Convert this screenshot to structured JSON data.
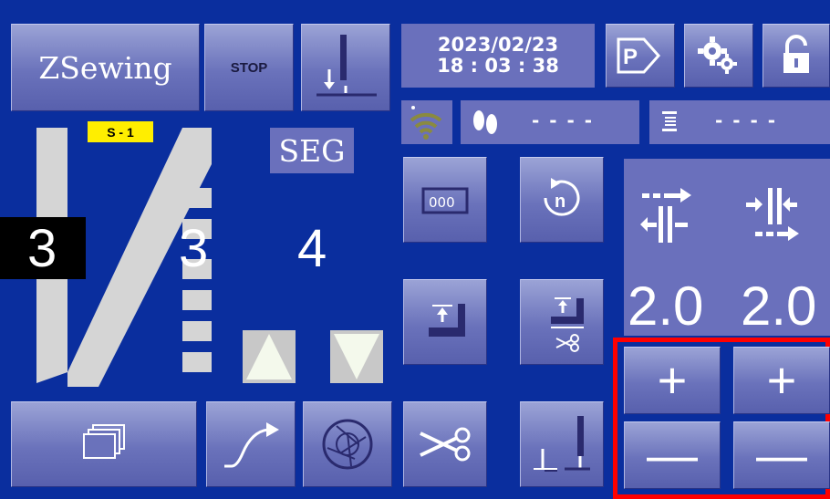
{
  "header": {
    "brand": "ZSewing",
    "stop_label": "STOP",
    "date": "2023/02/23",
    "time": "18 : 03 : 38"
  },
  "status": {
    "foot_count": "- - - -",
    "thread_count": "- - - -"
  },
  "pattern": {
    "step_tag": "S - 1",
    "left_value": "3",
    "right_value": "3",
    "seg_label": "SEG",
    "seg_value": "4"
  },
  "stitch": {
    "left_value": "2.0",
    "right_value": "2.0"
  },
  "adjust": {
    "plus": "+",
    "minus": "—"
  },
  "colors": {
    "background": "#0a2e9e",
    "button": "#6a72bb",
    "highlight": "#ff0000",
    "tag": "#ffee00"
  },
  "icons": [
    "program-icon",
    "settings-icon",
    "lock-icon",
    "wifi-icon",
    "foot-icon",
    "thread-icon",
    "counter-icon",
    "repeat-icon",
    "presser-up-icon",
    "trim-lift-icon",
    "scissors-icon",
    "needle-icon",
    "pages-icon",
    "curve-icon",
    "aperture-icon"
  ]
}
